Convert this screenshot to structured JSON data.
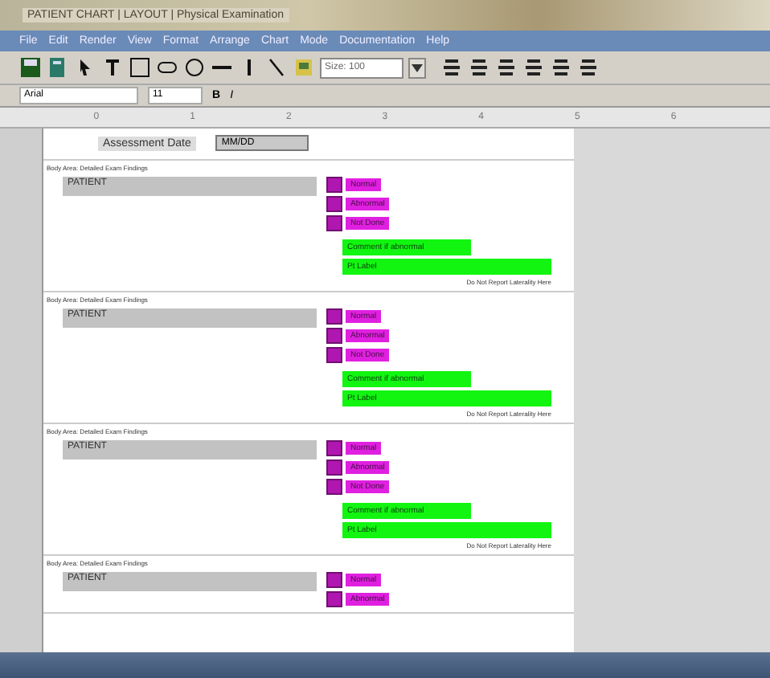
{
  "window": {
    "title": "PATIENT CHART | LAYOUT | Physical Examination"
  },
  "menu": [
    "File",
    "Edit",
    "Render",
    "View",
    "Format",
    "Arrange",
    "Chart",
    "Mode",
    "Documentation",
    "Help"
  ],
  "toolbar": [
    {
      "kind": "save"
    },
    {
      "kind": "book"
    },
    {
      "kind": "pointer"
    },
    {
      "kind": "text"
    },
    {
      "kind": "rect"
    },
    {
      "kind": "rounded"
    },
    {
      "kind": "oval"
    },
    {
      "kind": "line"
    },
    {
      "kind": "vline"
    },
    {
      "kind": "diag"
    },
    {
      "kind": "image"
    },
    {
      "kind": "dropdown",
      "value": "Size: 100"
    },
    {
      "kind": "align"
    },
    {
      "kind": "align"
    },
    {
      "kind": "align"
    },
    {
      "kind": "align"
    },
    {
      "kind": "align"
    },
    {
      "kind": "align"
    }
  ],
  "format_bar": {
    "font": "Arial",
    "size": "11",
    "bold": "B",
    "italic": "I"
  },
  "ruler": [
    "0",
    "1",
    "2",
    "3",
    "4",
    "5",
    "6"
  ],
  "header": {
    "label": "Assessment Date",
    "value": "MM/DD"
  },
  "sections": [
    {
      "caption": "Body Area: Detailed Exam Findings",
      "field": "PATIENT",
      "options": [
        {
          "label": "Normal",
          "checked": false
        },
        {
          "label": "Abnormal",
          "checked": false
        },
        {
          "label": "Not Done",
          "checked": false
        }
      ],
      "comment": "Comment if abnormal",
      "pt_label": "Pt Label",
      "note": "Do Not Report Laterality Here"
    },
    {
      "caption": "Body Area: Detailed Exam Findings",
      "field": "PATIENT",
      "options": [
        {
          "label": "Normal",
          "checked": false
        },
        {
          "label": "Abnormal",
          "checked": false
        },
        {
          "label": "Not Done",
          "checked": false
        }
      ],
      "comment": "Comment if abnormal",
      "pt_label": "Pt Label",
      "note": "Do Not Report Laterality Here"
    },
    {
      "caption": "Body Area: Detailed Exam Findings",
      "field": "PATIENT",
      "options": [
        {
          "label": "Normal",
          "checked": false
        },
        {
          "label": "Abnormal",
          "checked": false
        },
        {
          "label": "Not Done",
          "checked": false
        }
      ],
      "comment": "Comment if abnormal",
      "pt_label": "Pt Label",
      "note": "Do Not Report Laterality Here"
    },
    {
      "caption": "Body Area: Detailed Exam Findings",
      "field": "PATIENT",
      "options": [
        {
          "label": "Normal",
          "checked": false
        },
        {
          "label": "Abnormal",
          "checked": false
        }
      ]
    }
  ]
}
